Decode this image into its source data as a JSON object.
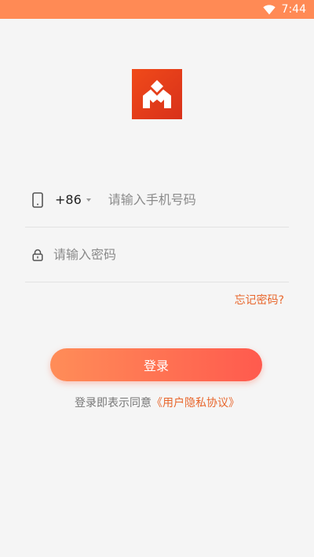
{
  "status_bar": {
    "time": "7:44"
  },
  "login_form": {
    "country_code": "+86",
    "phone_placeholder": "请输入手机号码",
    "password_placeholder": "请输入密码",
    "forgot_password": "忘记密码?",
    "login_button": "登录",
    "agreement_prefix": "登录即表示同意",
    "agreement_link": "《用户隐私协议》"
  },
  "colors": {
    "status_bar": "#ff8a55",
    "accent": "#e8662c",
    "button_start": "#ff8d58",
    "button_end": "#ff5a4e",
    "logo": "#e43d1a"
  }
}
